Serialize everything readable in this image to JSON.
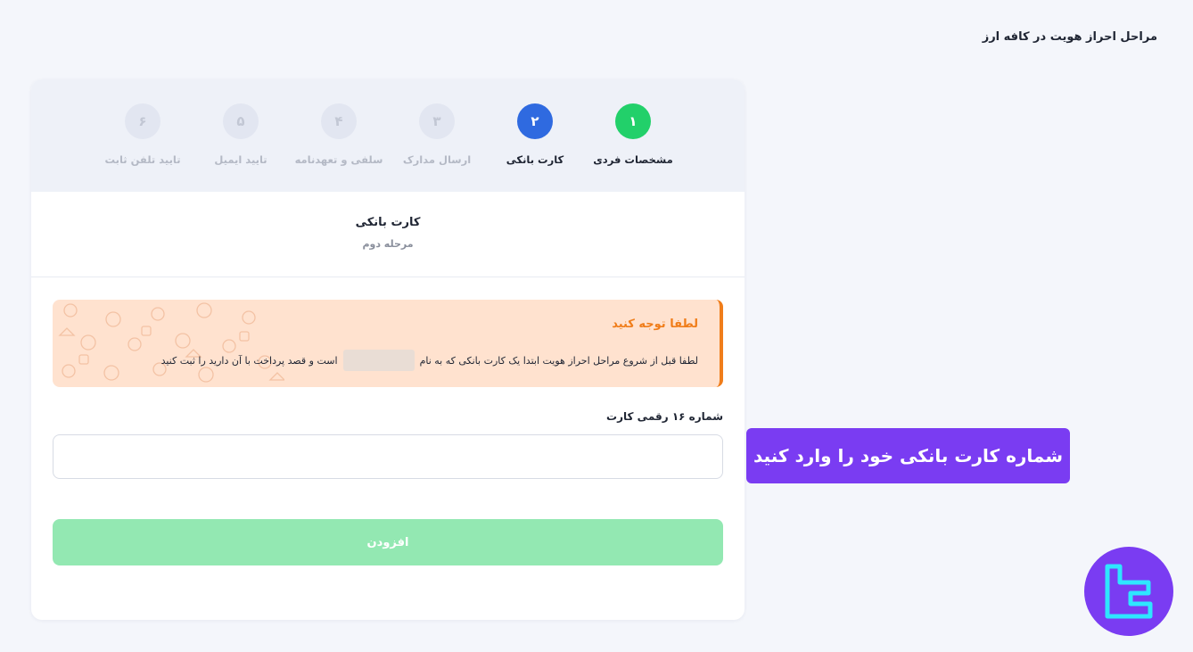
{
  "page_heading": "مراحل احراز هویت در کافه ارز",
  "steps": [
    {
      "number": "۱",
      "label": "مشخصات فردی",
      "state": "done"
    },
    {
      "number": "۲",
      "label": "کارت بانکی",
      "state": "active"
    },
    {
      "number": "۳",
      "label": "ارسال مدارک",
      "state": "pending"
    },
    {
      "number": "۴",
      "label": "سلفی و تعهدنامه",
      "state": "pending"
    },
    {
      "number": "۵",
      "label": "تایید ایمیل",
      "state": "pending"
    },
    {
      "number": "۶",
      "label": "تایید تلفن ثابت",
      "state": "pending"
    }
  ],
  "section": {
    "title": "کارت بانکی",
    "subtitle": "مرحله دوم"
  },
  "alert": {
    "title": "لطفا توجه کنید",
    "text_before": "لطفا قبل از شروع مراحل احراز هویت ابتدا یک کارت بانکی که به نام",
    "text_after": "است و قصد پرداخت با آن دارید را ثبت کنید"
  },
  "card_field": {
    "label": "شماره ۱۶ رقمی کارت",
    "value": "",
    "placeholder": ""
  },
  "add_button_label": "افزودن",
  "callout_text": "شماره کارت بانکی خود را وارد کنید",
  "colors": {
    "done": "#22d06a",
    "active": "#2f6ae0",
    "alert_accent": "#f07d1a",
    "button_disabled": "#93e8b2",
    "callout": "#7a3cf2"
  }
}
